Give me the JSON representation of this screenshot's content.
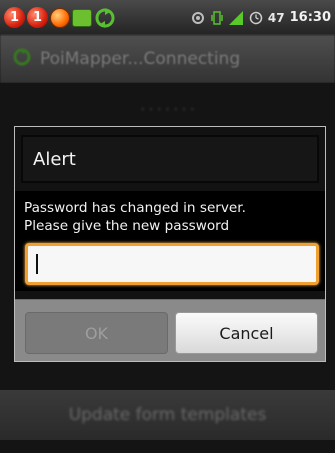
{
  "status_bar": {
    "badge_1": "1",
    "badge_2": "1",
    "signal_count": "47",
    "clock": "16:30"
  },
  "app": {
    "title": "PoiMapper...Connecting"
  },
  "underlay": {
    "bottom_button_label": "Update form templates"
  },
  "dialog": {
    "title": "Alert",
    "message_line_1": "Password has changed in server.",
    "message_line_2": "Please give the new password",
    "password_value": "",
    "ok_label": "OK",
    "cancel_label": "Cancel"
  },
  "colors": {
    "accent_focus": "#f0a030",
    "disabled_button": "#7a7a7a",
    "dialog_background": "#000000"
  },
  "icons": [
    "notification-badge-icon",
    "sms-icon",
    "sync-icon",
    "gps-icon",
    "vibrate-icon",
    "signal-icon",
    "alarm-icon",
    "app-sync-icon"
  ]
}
